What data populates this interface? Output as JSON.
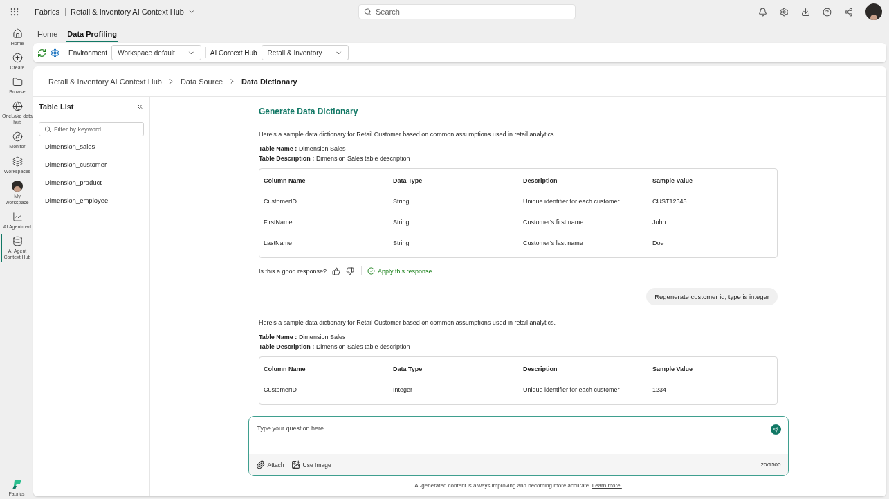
{
  "top_bar": {
    "app": "Fabrics",
    "workspace": "Retail & Inventory AI Context Hub",
    "search": {
      "placeholder": "Search"
    }
  },
  "nav_rail": {
    "items": [
      {
        "label": "Home",
        "selected": false
      },
      {
        "label": "Create",
        "selected": false
      },
      {
        "label": "Browse",
        "selected": false
      },
      {
        "label": "OneLake data hub",
        "selected": false
      },
      {
        "label": "Monitor",
        "selected": false
      },
      {
        "label": "Workspaces",
        "selected": false
      },
      {
        "label": "My workspace",
        "selected": false
      },
      {
        "label": "AI Agentmart",
        "selected": false
      },
      {
        "label": "AI Agent Context Hub",
        "selected": true
      }
    ],
    "brand": "Fabrics"
  },
  "tabs": [
    {
      "label": "Home",
      "selected": false
    },
    {
      "label": "Data Profiling",
      "selected": true
    }
  ],
  "toolbar": {
    "environment_label": "Environment",
    "environment": "Workspace default",
    "hub_label": "AI Context Hub",
    "hub": "Retail & Inventory"
  },
  "breadcrumb": [
    "Retail & Inventory AI Context Hub",
    "Data Source",
    "Data Dictionary"
  ],
  "table_list": {
    "title": "Table List",
    "filter": {
      "placeholder": "Filter by keyword"
    },
    "items": [
      {
        "label": "Dimension_sales",
        "selected": false
      },
      {
        "label": "Dimension_customer",
        "selected": false
      },
      {
        "label": "Dimension_product",
        "selected": false
      },
      {
        "label": "Dimension_employee",
        "selected": false
      }
    ]
  },
  "chat": {
    "title": "Generate Data Dictionary",
    "messages": [
      {
        "kind": "answer",
        "intro": "Here's a sample data dictionary for Retail Customer based on common assumptions used in retail analytics.",
        "table_name_label": "Table Name :",
        "table_name": "Dimension Sales",
        "table_desc_label": "Table Description :",
        "table_desc": "Dimension Sales table description",
        "columns": [
          "Column Name",
          "Data Type",
          "Description",
          "Sample Value"
        ],
        "rows": [
          [
            "CustomerID",
            "String",
            "Unique identifier for each customer",
            "CUST12345"
          ],
          [
            "FirstName",
            "String",
            "Customer's first name",
            "John"
          ],
          [
            "LastName",
            "String",
            "Customer's last name",
            "Doe"
          ]
        ],
        "feedback": {
          "question": "Is this a good response?",
          "apply": "Apply this response"
        }
      },
      {
        "kind": "user",
        "text": "Regenerate customer id, type is integer"
      },
      {
        "kind": "answer",
        "intro": "Here's a sample data dictionary for Retail Customer based on common assumptions used in retail analytics.",
        "table_name_label": "Table Name :",
        "table_name": "Dimension Sales",
        "table_desc_label": "Table Description :",
        "table_desc": "Dimension Sales table description",
        "columns": [
          "Column Name",
          "Data Type",
          "Description",
          "Sample Value"
        ],
        "rows": [
          [
            "CustomerID",
            "Integer",
            "Unique identifier for each customer",
            "1234"
          ]
        ]
      }
    ]
  },
  "composer": {
    "placeholder": "Type your question here...",
    "attach": "Attach",
    "use_image": "Use Image",
    "count": "20/1500"
  },
  "disclaimer": {
    "text": "AI-generated content is always improving and becoming more accurate.",
    "link": "Learn more."
  }
}
